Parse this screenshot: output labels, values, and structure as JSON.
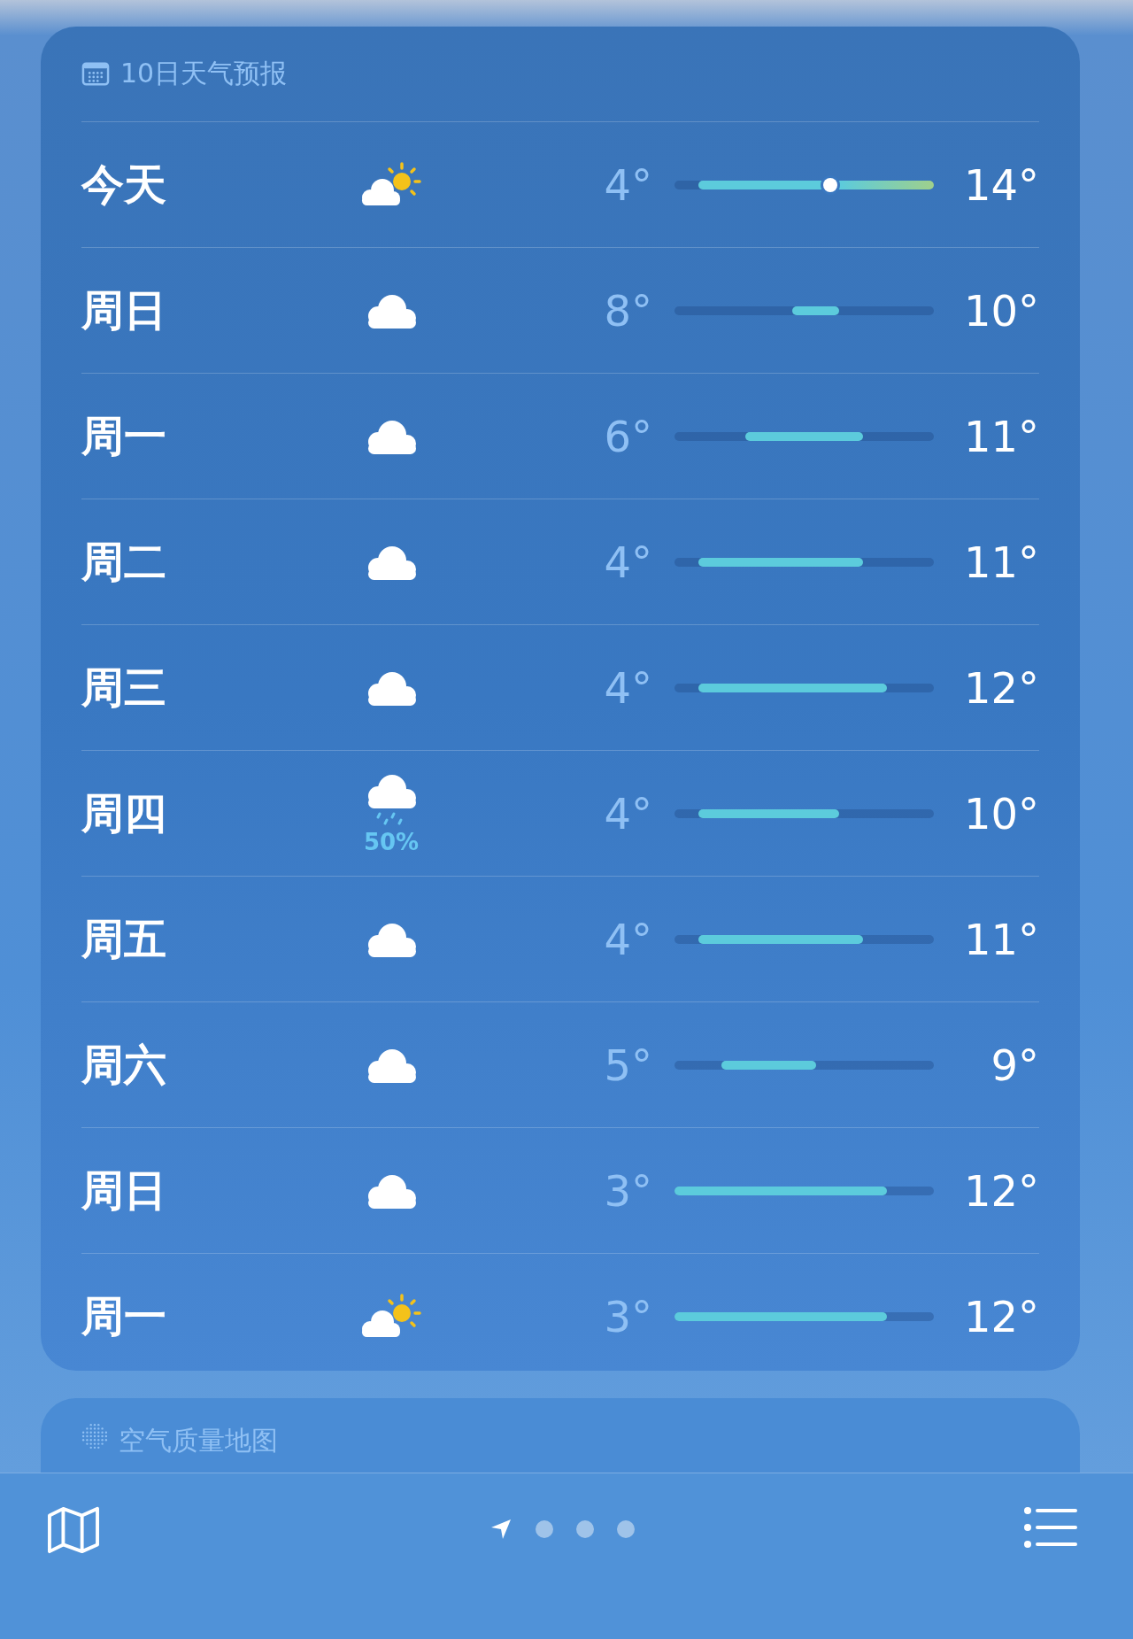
{
  "forecast": {
    "title": "10日天气预报",
    "days": [
      {
        "day": "今天",
        "kind": "partly-sunny",
        "low": "4°",
        "high": "14°",
        "level": 0.6
      },
      {
        "day": "周日",
        "kind": "cloudy",
        "low": "8°",
        "high": "10°"
      },
      {
        "day": "周一",
        "kind": "cloudy",
        "low": "6°",
        "high": "11°"
      },
      {
        "day": "周二",
        "kind": "cloudy",
        "low": "4°",
        "high": "11°"
      },
      {
        "day": "周三",
        "kind": "cloudy",
        "low": "4°",
        "high": "12°"
      },
      {
        "day": "周四",
        "kind": "rain",
        "precipitation": "50%",
        "low": "4°",
        "high": "10°"
      },
      {
        "day": "周五",
        "kind": "cloudy",
        "low": "4°",
        "high": "11°"
      },
      {
        "day": "周六",
        "kind": "cloudy",
        "low": "5°",
        "high": "9°"
      },
      {
        "day": "周日",
        "kind": "cloudy",
        "low": "3°",
        "high": "12°"
      },
      {
        "day": "周一",
        "kind": "partly-sunny",
        "low": "3°",
        "high": "12°"
      }
    ]
  },
  "air_quality": {
    "title": "空气质量地图"
  },
  "toolbar": {
    "pages": [
      {
        "kind": "location",
        "selected": true
      },
      {
        "kind": "dot",
        "selected": false
      },
      {
        "kind": "dot",
        "selected": false
      },
      {
        "kind": "dot",
        "selected": false
      }
    ]
  }
}
